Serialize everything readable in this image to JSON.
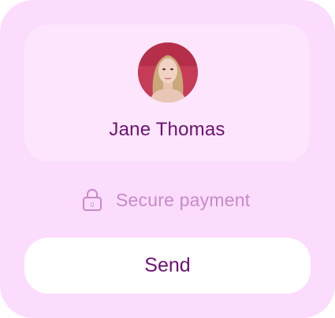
{
  "recipient": {
    "name": "Jane Thomas",
    "avatar_alt": "Profile photo"
  },
  "security": {
    "label": "Secure payment",
    "icon": "lock-icon"
  },
  "actions": {
    "send_label": "Send"
  },
  "colors": {
    "card_background": "#fcdcfc",
    "panel_background": "#fde6fd",
    "primary_text": "#6b1270",
    "muted_text": "#c78ac9",
    "button_background": "#ffffff"
  }
}
